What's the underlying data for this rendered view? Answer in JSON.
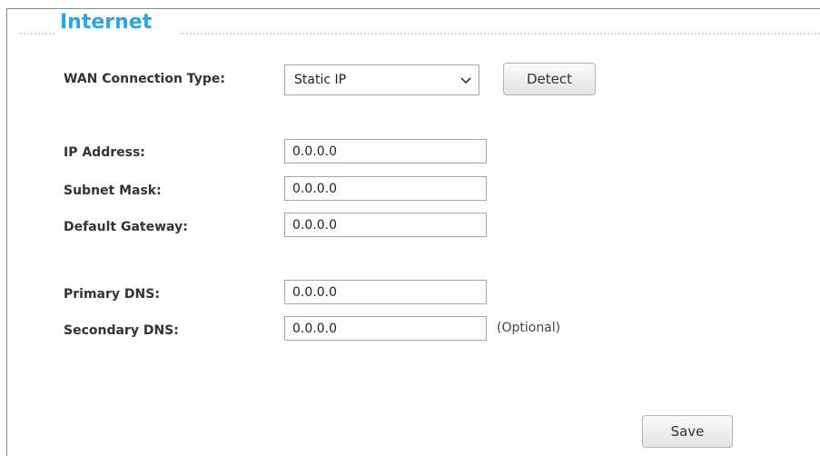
{
  "section": {
    "title": "Internet"
  },
  "wan": {
    "label": "WAN Connection Type:",
    "selected": "Static IP",
    "detect_label": "Detect"
  },
  "fields": {
    "ip_address": {
      "label": "IP Address:",
      "value": "0.0.0.0"
    },
    "subnet_mask": {
      "label": "Subnet Mask:",
      "value": "0.0.0.0"
    },
    "default_gateway": {
      "label": "Default Gateway:",
      "value": "0.0.0.0"
    },
    "primary_dns": {
      "label": "Primary DNS:",
      "value": "0.0.0.0"
    },
    "secondary_dns": {
      "label": "Secondary DNS:",
      "value": "0.0.0.0",
      "note": "(Optional)"
    }
  },
  "actions": {
    "save_label": "Save"
  },
  "colors": {
    "title_accent": "#29a6e5"
  },
  "icons": {
    "select_arrow": "chevron-down-icon"
  }
}
